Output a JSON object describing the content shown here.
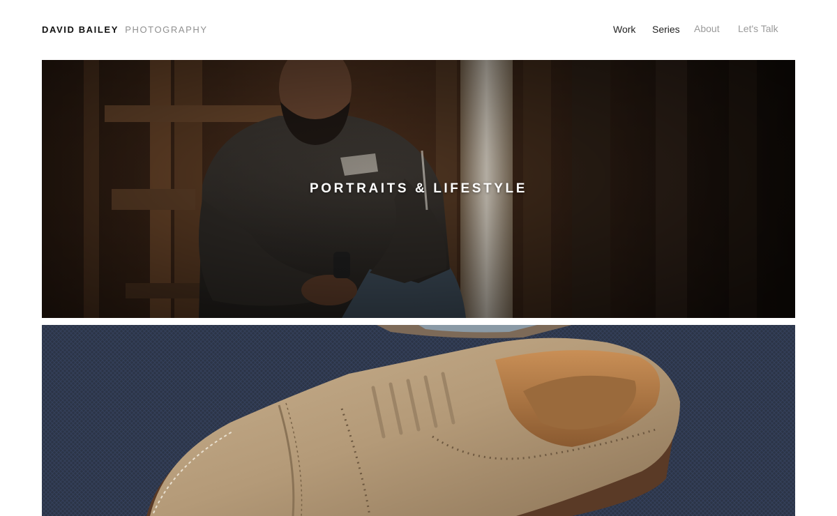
{
  "site": {
    "name": "DAVID BAILEY",
    "tagline": "PHOTOGRAPHY"
  },
  "nav": {
    "items": [
      {
        "label": "Work",
        "state": "normal"
      },
      {
        "label": "Series",
        "state": "normal"
      },
      {
        "label": "About",
        "state": "muted"
      },
      {
        "label": "Let's Talk",
        "state": "muted"
      }
    ]
  },
  "gallery": {
    "panels": [
      {
        "title": "PORTRAITS & LIFESTYLE",
        "image": "portrait-photo"
      },
      {
        "title": "",
        "image": "suede-shoe-photo"
      }
    ]
  },
  "colors": {
    "text_dark": "#111111",
    "text_muted": "#9a9a9a",
    "barn_wood": "#3a2517",
    "fabric_navy": "#2b3447",
    "suede_tan": "#b49a78"
  }
}
